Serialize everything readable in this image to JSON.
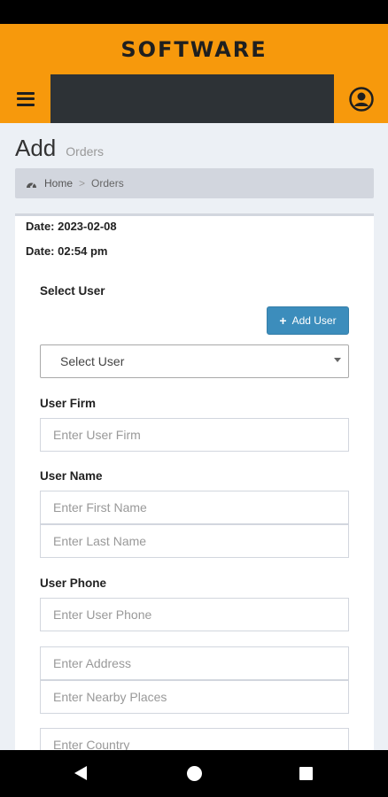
{
  "app": {
    "brand": "SOFTWARE"
  },
  "header": {
    "title": "Add",
    "subtitle": "Orders"
  },
  "breadcrumb": {
    "home": "Home",
    "separator": ">",
    "current": "Orders"
  },
  "meta": {
    "date_line": "Date: 2023-02-08",
    "time_line": "Date: 02:54 pm"
  },
  "form": {
    "select_user_label": "Select User",
    "add_user_label": "Add User",
    "select_user_value": "Select User",
    "user_firm_label": "User Firm",
    "user_firm_placeholder": "Enter User Firm",
    "user_name_label": "User Name",
    "first_name_placeholder": "Enter First Name",
    "last_name_placeholder": "Enter Last Name",
    "user_phone_label": "User Phone",
    "user_phone_placeholder": "Enter User Phone",
    "address_placeholder": "Enter Address",
    "nearby_placeholder": "Enter Nearby Places",
    "country_placeholder": "Enter Country"
  },
  "icons": {
    "menu": "hamburger-icon",
    "account": "user-circle-icon",
    "home": "dashboard-icon",
    "add": "plus-icon",
    "dropdown": "caret-down-icon"
  },
  "colors": {
    "accent": "#f7990c",
    "nav_dark": "#2d3236",
    "primary_button": "#3c8dbc"
  }
}
